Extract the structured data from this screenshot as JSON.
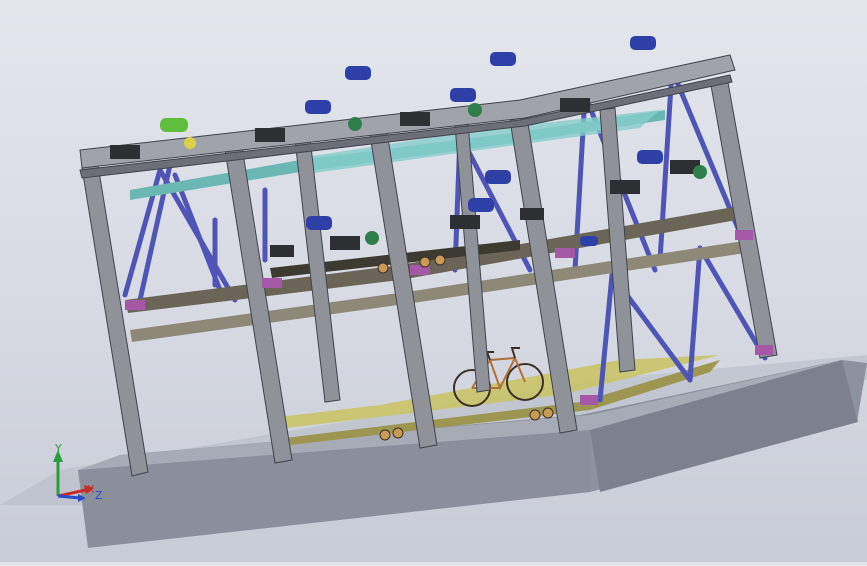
{
  "viewport": {
    "triad": {
      "y_label": "Y",
      "x_label": "X",
      "z_label": "Z"
    }
  }
}
